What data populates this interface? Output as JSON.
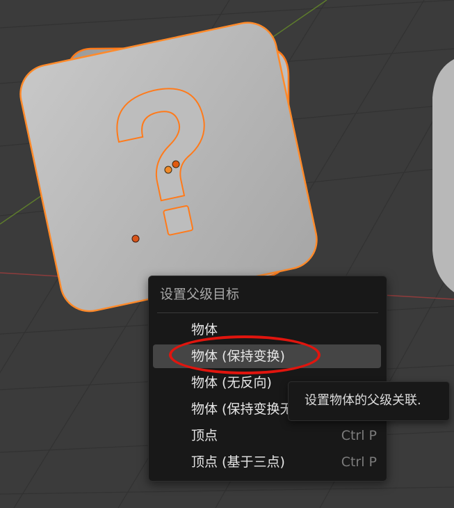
{
  "menu": {
    "title": "设置父级目标",
    "items": [
      {
        "label": "物体",
        "shortcut": "",
        "active": false
      },
      {
        "label": "物体 (保持变换)",
        "shortcut": "",
        "active": true
      },
      {
        "label": "物体 (无反向)",
        "shortcut": "",
        "active": false
      },
      {
        "label": "物体 (保持变换无反向)",
        "shortcut": "",
        "active": false
      },
      {
        "label": "顶点",
        "shortcut": "Ctrl P",
        "active": false
      },
      {
        "label": "顶点 (基于三点)",
        "shortcut": "Ctrl P",
        "active": false
      }
    ]
  },
  "tooltip": {
    "text": "设置物体的父级关联."
  },
  "colors": {
    "viewport_bg": "#3b3b3b",
    "grid": "#2f2f2f",
    "axis_x": "#8a3a3a",
    "axis_y": "#5a7a2a",
    "selection_outline": "#ff7a1a",
    "highlight_ellipse": "#e0150e",
    "object_gray": "#b4b4b4"
  },
  "icons": [
    "question-mark-block",
    "object-origin-dot"
  ]
}
